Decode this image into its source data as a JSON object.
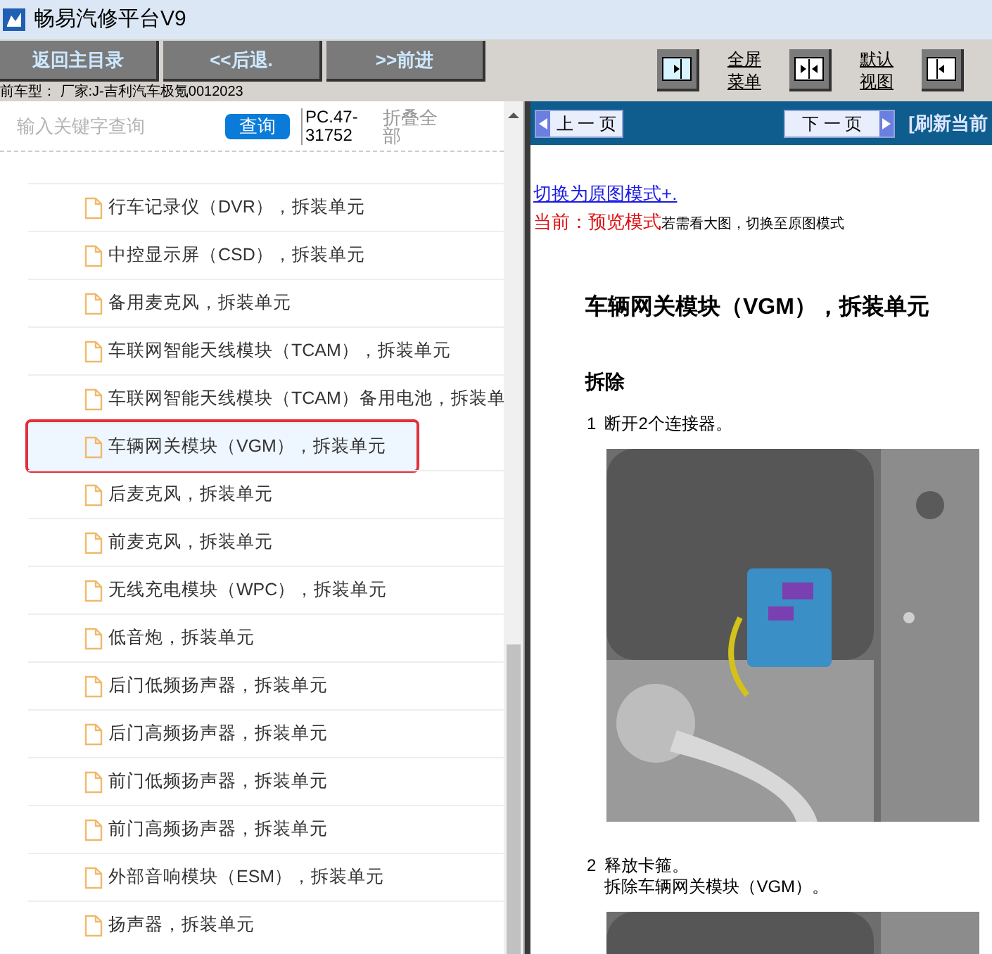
{
  "window": {
    "title": "畅易汽修平台V9"
  },
  "toolbar": {
    "buttons": [
      "返回主目录",
      "<<后退.",
      ">>前进"
    ],
    "view_buttons": [
      {
        "kind": "right",
        "label": [
          "全屏",
          "菜单"
        ]
      },
      {
        "kind": "both",
        "label": [
          "默认",
          "视图"
        ]
      },
      {
        "kind": "left"
      }
    ]
  },
  "vehicle": "前车型：  厂家:J-吉利汽车极氪0012023",
  "search": {
    "placeholder": "输入关键字查询",
    "button": "查询",
    "code": "PC.47-31752",
    "collapse": "折叠全部"
  },
  "items": [
    {
      "label": "行车记录仪（DVR），拆装单元",
      "selected": false
    },
    {
      "label": "中控显示屏（CSD），拆装单元",
      "selected": false
    },
    {
      "label": "备用麦克风，拆装单元",
      "selected": false
    },
    {
      "label": "车联网智能天线模块（TCAM），拆装单元",
      "selected": false
    },
    {
      "label": "车联网智能天线模块（TCAM）备用电池，拆装单",
      "selected": false
    },
    {
      "label": "车辆网关模块（VGM），拆装单元",
      "selected": true
    },
    {
      "label": "后麦克风，拆装单元",
      "selected": false
    },
    {
      "label": "前麦克风，拆装单元",
      "selected": false
    },
    {
      "label": "无线充电模块（WPC），拆装单元",
      "selected": false
    },
    {
      "label": "低音炮，拆装单元",
      "selected": false
    },
    {
      "label": "后门低频扬声器，拆装单元",
      "selected": false
    },
    {
      "label": "后门高频扬声器，拆装单元",
      "selected": false
    },
    {
      "label": "前门低频扬声器，拆装单元",
      "selected": false
    },
    {
      "label": "前门高频扬声器，拆装单元",
      "selected": false
    },
    {
      "label": "外部音响模块（ESM），拆装单元",
      "selected": false
    },
    {
      "label": "扬声器，拆装单元",
      "selected": false
    }
  ],
  "pager": {
    "prev": "上 一 页",
    "next": "下 一 页",
    "refresh": "[刷新当前"
  },
  "doc": {
    "switch_link": "切换为原图模式+.",
    "mode_label": "当前：预览模式",
    "mode_hint": "若需看大图，切换至原图模式",
    "title": "车辆网关模块（VGM），拆装单元",
    "section": "拆除",
    "steps": [
      {
        "number": "1",
        "lines": [
          "断开2个连接器。"
        ]
      },
      {
        "number": "2",
        "lines": [
          "释放卡箍。",
          "拆除车辆网关模块（VGM）。"
        ]
      }
    ]
  }
}
